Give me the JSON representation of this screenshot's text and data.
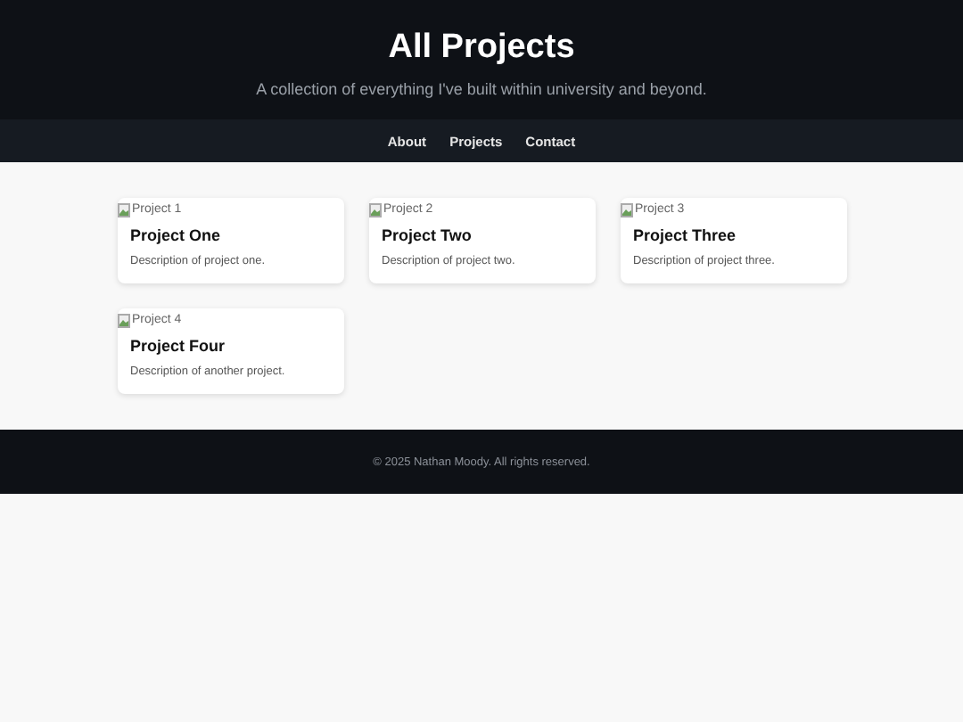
{
  "header": {
    "title": "All Projects",
    "subtitle": "A collection of everything I've built within university and beyond."
  },
  "nav": {
    "links": [
      "About",
      "Projects",
      "Contact"
    ]
  },
  "projects": [
    {
      "image_alt": "Project 1",
      "title": "Project One",
      "description": "Description of project one."
    },
    {
      "image_alt": "Project 2",
      "title": "Project Two",
      "description": "Description of project two."
    },
    {
      "image_alt": "Project 3",
      "title": "Project Three",
      "description": "Description of project three."
    },
    {
      "image_alt": "Project 4",
      "title": "Project Four",
      "description": "Description of another project."
    }
  ],
  "footer": {
    "text": "© 2025 Nathan Moody. All rights reserved."
  }
}
